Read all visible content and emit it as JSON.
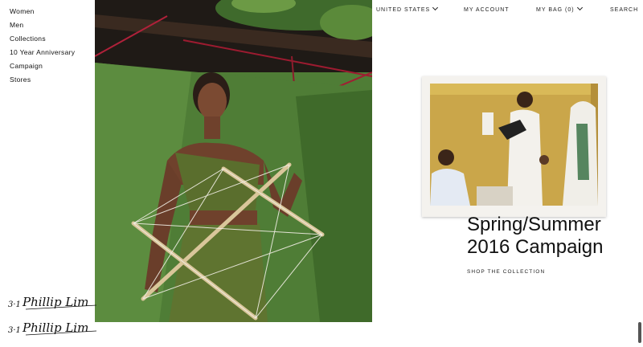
{
  "nav": {
    "items": [
      {
        "label": "Women"
      },
      {
        "label": "Men"
      },
      {
        "label": "Collections"
      },
      {
        "label": "10 Year Anniversary"
      },
      {
        "label": "Campaign"
      },
      {
        "label": "Stores"
      }
    ]
  },
  "topbar": {
    "region": "UNITED STATES",
    "account": "MY ACCOUNT",
    "bag": "MY BAG (0)",
    "search": "SEARCH"
  },
  "campaign": {
    "title_line1": "Spring/Summer",
    "title_line2": "2016 Campaign",
    "cta": "SHOP THE COLLECTION"
  },
  "brand": {
    "logo_text": "3.1 Phillip Lim"
  },
  "colors": {
    "background": "#ffffff",
    "hero_green": "#4f7d36",
    "polaroid_wall": "#caa64a"
  }
}
